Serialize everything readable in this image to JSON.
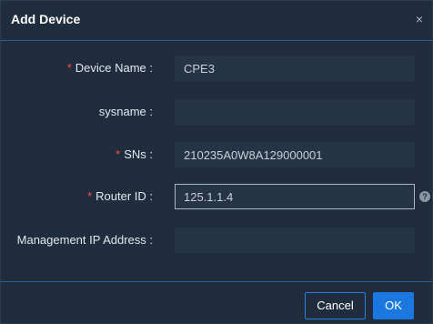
{
  "dialog": {
    "title": "Add Device",
    "close_symbol": "×"
  },
  "fields": [
    {
      "label": "Device Name :",
      "required": true,
      "value": "CPE3"
    },
    {
      "label": "sysname :",
      "required": false,
      "value": ""
    },
    {
      "label": "SNs :",
      "required": true,
      "value": "210235A0W8A129000001"
    },
    {
      "label": "Router ID :",
      "required": true,
      "value": "125.1.1.4",
      "help_icon": "?"
    },
    {
      "label": "Management IP Address :",
      "required": false,
      "value": ""
    }
  ],
  "required_marker": "*",
  "buttons": {
    "cancel": "Cancel",
    "ok": "OK"
  },
  "colors": {
    "background": "#1f2d3e",
    "input_bg": "#253446",
    "accent": "#1a78e0",
    "required": "#ff4d4f"
  }
}
